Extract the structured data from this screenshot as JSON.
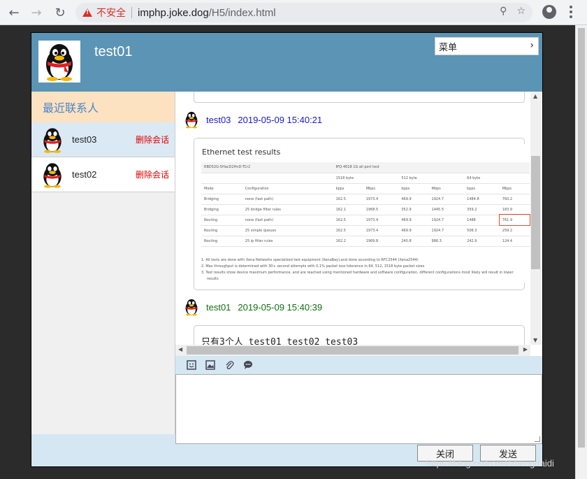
{
  "browser": {
    "security_label": "不安全",
    "url_host": "imphp.joke.dog",
    "url_path": "/H5/index.html"
  },
  "chat": {
    "header": {
      "user_name": "test01",
      "menu_label": "菜单"
    },
    "sidebar": {
      "title": "最近联系人",
      "contacts": [
        {
          "name": "test03",
          "action": "删除会话",
          "active": true
        },
        {
          "name": "test02",
          "action": "删除会话",
          "active": false
        }
      ]
    },
    "messages": [
      {
        "sender": "test03",
        "time": "2019-05-09 15:40:21",
        "type": "image"
      },
      {
        "sender": "test01",
        "time": "2019-05-09 15:40:39",
        "type": "text",
        "text": "只有3个人 test01 test02 test03"
      }
    ],
    "image_content": {
      "title": "Ethernet test results",
      "table_head": [
        "RBD52G-5HacD2HnD-TCr2",
        "IPQ-4018 1G all port test"
      ],
      "size_row": [
        "1518 byte",
        "512 byte",
        "64 byte"
      ],
      "col_head": [
        "Mode",
        "Configuration",
        "kpps",
        "Mbps",
        "kpps",
        "Mbps",
        "kpps",
        "Mbps"
      ],
      "rows": [
        [
          "Bridging",
          "none (fast path)",
          "162.5",
          "1973.4",
          "469.9",
          "1924.7",
          "1484.8",
          "760.2"
        ],
        [
          "Bridging",
          "25 bridge filter rules",
          "162.1",
          "1968.5",
          "352.9",
          "1445.5",
          "359.2",
          "183.9"
        ],
        [
          "Routing",
          "none (fast path)",
          "162.5",
          "1973.4",
          "469.9",
          "1924.7",
          "1488",
          "761.9"
        ],
        [
          "Routing",
          "25 simple queues",
          "162.5",
          "1973.4",
          "469.9",
          "1924.7",
          "506.3",
          "259.2"
        ],
        [
          "Routing",
          "25 ip filter rules",
          "162.2",
          "1969.8",
          "240.8",
          "986.3",
          "242.9",
          "124.4"
        ]
      ],
      "notes": [
        "1. All tests are done with Xena Networks specialized test equipment (XenaBay),and done according to RFC2544 (Xena2544)",
        "2. Max throughput is determined with 30+ second attempts with 0,1% packet loss tolerance in 64, 512, 1518 byte packet sizes",
        "3. Test results show device maximum performance, and are reached using mentioned hardware and software configuration, different configurations most likely will result in lower",
        "results"
      ]
    },
    "buttons": {
      "close": "关闭",
      "send": "发送"
    },
    "toolbar_icons": [
      "emoji-icon",
      "image-icon",
      "attachment-icon",
      "chat-bubble-icon"
    ]
  },
  "watermark": "https://blog.csdn.net/zhengdaidi"
}
